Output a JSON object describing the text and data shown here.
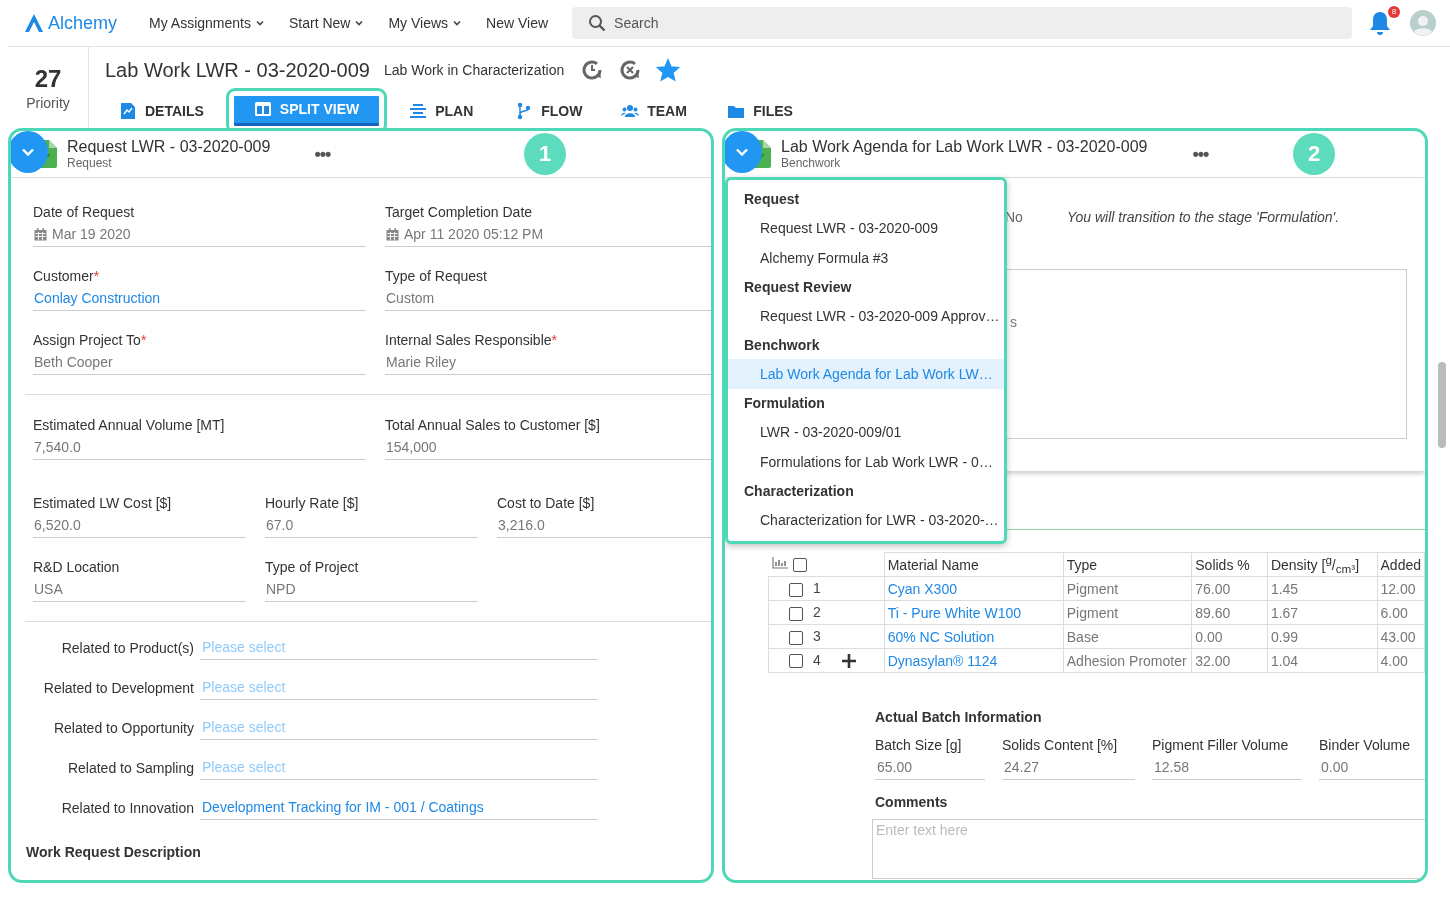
{
  "nav": {
    "logo": "Alchemy",
    "menus": [
      {
        "label": "My Assignments",
        "dropdown": true
      },
      {
        "label": "Start New",
        "dropdown": true
      },
      {
        "label": "My Views",
        "dropdown": true
      },
      {
        "label": "New View",
        "dropdown": false
      }
    ],
    "search": {
      "placeholder": "Search"
    },
    "notifications": "8"
  },
  "record": {
    "priority": "27",
    "priority_label": "Priority",
    "title": "Lab Work LWR - 03-2020-009",
    "stage": "Lab Work in Characterization",
    "starred": true,
    "tabs": [
      {
        "label": "DETAILS",
        "kind": "details",
        "selected": false
      },
      {
        "label": "SPLIT VIEW",
        "kind": "split",
        "selected": true
      },
      {
        "label": "PLAN",
        "kind": "plan",
        "selected": false
      },
      {
        "label": "FLOW",
        "kind": "flow",
        "selected": false
      },
      {
        "label": "TEAM",
        "kind": "team",
        "selected": false
      },
      {
        "label": "FILES",
        "kind": "files",
        "selected": false
      }
    ]
  },
  "left_panel": {
    "title": "Request LWR - 03-2020-009",
    "subtitle": "Request",
    "more": "•••",
    "badge": "1",
    "groups": [
      {
        "rows": [
          {
            "kind": "two",
            "fields": [
              {
                "label": "Date of Request",
                "value": "Mar 19 2020",
                "kind": "date"
              },
              {
                "label": "Target Completion Date",
                "value": "Apr 11 2020 05:12 PM",
                "kind": "date"
              },
              {
                "label": "Customer",
                "required_mark": "*",
                "value": "Conlay Construction",
                "kind": "link"
              },
              {
                "label": "Type of Request",
                "value": "Custom",
                "kind": "text"
              },
              {
                "label": "Assign Project To",
                "required_mark": "*",
                "value": "Beth Cooper",
                "kind": "text"
              },
              {
                "label": "Internal Sales Responsible",
                "required_mark": "*",
                "value": "Marie Riley",
                "kind": "text"
              }
            ]
          }
        ]
      },
      {
        "rows": [
          {
            "kind": "two",
            "fields": [
              {
                "label": "Estimated Annual Volume [MT]",
                "value": "7,540.0",
                "kind": "text"
              },
              {
                "label": "Total Annual Sales to Customer [$]",
                "value": "154,000",
                "kind": "text"
              }
            ]
          },
          {
            "kind": "three",
            "fields": [
              {
                "label": "Estimated LW Cost [$]",
                "value": "6,520.0",
                "kind": "text"
              },
              {
                "label": "Hourly Rate [$]",
                "value": "67.0",
                "kind": "text"
              },
              {
                "label": "Cost to Date [$]",
                "value": "3,216.0",
                "kind": "text"
              },
              {
                "label": "R&D Location",
                "value": "USA",
                "kind": "text"
              },
              {
                "label": "Type of Project",
                "value": "NPD",
                "kind": "text"
              }
            ]
          }
        ]
      }
    ],
    "related": [
      {
        "label": "Related to Product(s)",
        "placeholder": "Please select"
      },
      {
        "label": "Related to Development",
        "placeholder": "Please select"
      },
      {
        "label": "Related to Opportunity",
        "placeholder": "Please select"
      },
      {
        "label": "Related to Sampling",
        "placeholder": "Please select"
      },
      {
        "label": "Related to Innovation",
        "value": "Development Tracking for IM - 001 / Coatings"
      }
    ],
    "description_heading": "Work Request Description"
  },
  "right_panel": {
    "title": "Lab Work Agenda for Lab Work LWR - 03-2020-009",
    "subtitle": "Benchwork",
    "more": "•••",
    "badge": "2",
    "transition": {
      "answer": "No",
      "message": "You will transition to the stage 'Formulation'."
    },
    "note_fragment": "s",
    "menu": {
      "groups": [
        {
          "label": "Request",
          "items": [
            {
              "label": "Request LWR - 03-2020-009",
              "selected": false
            },
            {
              "label": "Alchemy Formula #3",
              "selected": false
            }
          ]
        },
        {
          "label": "Request Review",
          "items": [
            {
              "label": "Request LWR - 03-2020-009 Approv…",
              "selected": false
            }
          ]
        },
        {
          "label": "Benchwork",
          "items": [
            {
              "label": "Lab Work Agenda for Lab Work LW…",
              "selected": true
            }
          ]
        },
        {
          "label": "Formulation",
          "items": [
            {
              "label": "LWR - 03-2020-009/01",
              "selected": false
            },
            {
              "label": "Formulations for Lab Work LWR - 0…",
              "selected": false
            }
          ]
        },
        {
          "label": "Characterization",
          "items": [
            {
              "label": "Characterization for LWR - 03-2020-…",
              "selected": false
            }
          ]
        }
      ]
    },
    "table": {
      "select_all": false,
      "columns": [
        "Material Name",
        "Type",
        "Solids %",
        "Density [$^{g}$/$_{cm³}$]",
        "Added"
      ],
      "rows": [
        {
          "number": "1",
          "checked": false,
          "add_handle": false,
          "cells": [
            "Cyan X300",
            "Pigment",
            "76.00",
            "1.45",
            "12.00"
          ]
        },
        {
          "number": "2",
          "checked": false,
          "add_handle": false,
          "cells": [
            "Ti - Pure White W100",
            "Pigment",
            "89.60",
            "1.67",
            "6.00"
          ]
        },
        {
          "number": "3",
          "checked": false,
          "add_handle": false,
          "cells": [
            "60% NC Solution",
            "Base",
            "0.00",
            "0.99",
            "43.00"
          ]
        },
        {
          "number": "4",
          "checked": false,
          "add_handle": true,
          "cells": [
            "Dynasylan® 1124",
            "Adhesion Promoter",
            "32.00",
            "1.04",
            "4.00"
          ]
        }
      ]
    },
    "batch": {
      "heading": "Actual Batch Information",
      "fields": [
        {
          "label": "Batch Size [g]",
          "value": "65.00"
        },
        {
          "label": "Solids Content [%]",
          "value": "24.27"
        },
        {
          "label": "Pigment Filler Volume",
          "value": "12.58"
        },
        {
          "label": "Binder Volume",
          "value": "0.00"
        }
      ]
    },
    "comments": {
      "heading": "Comments",
      "placeholder": "Enter text here"
    }
  }
}
